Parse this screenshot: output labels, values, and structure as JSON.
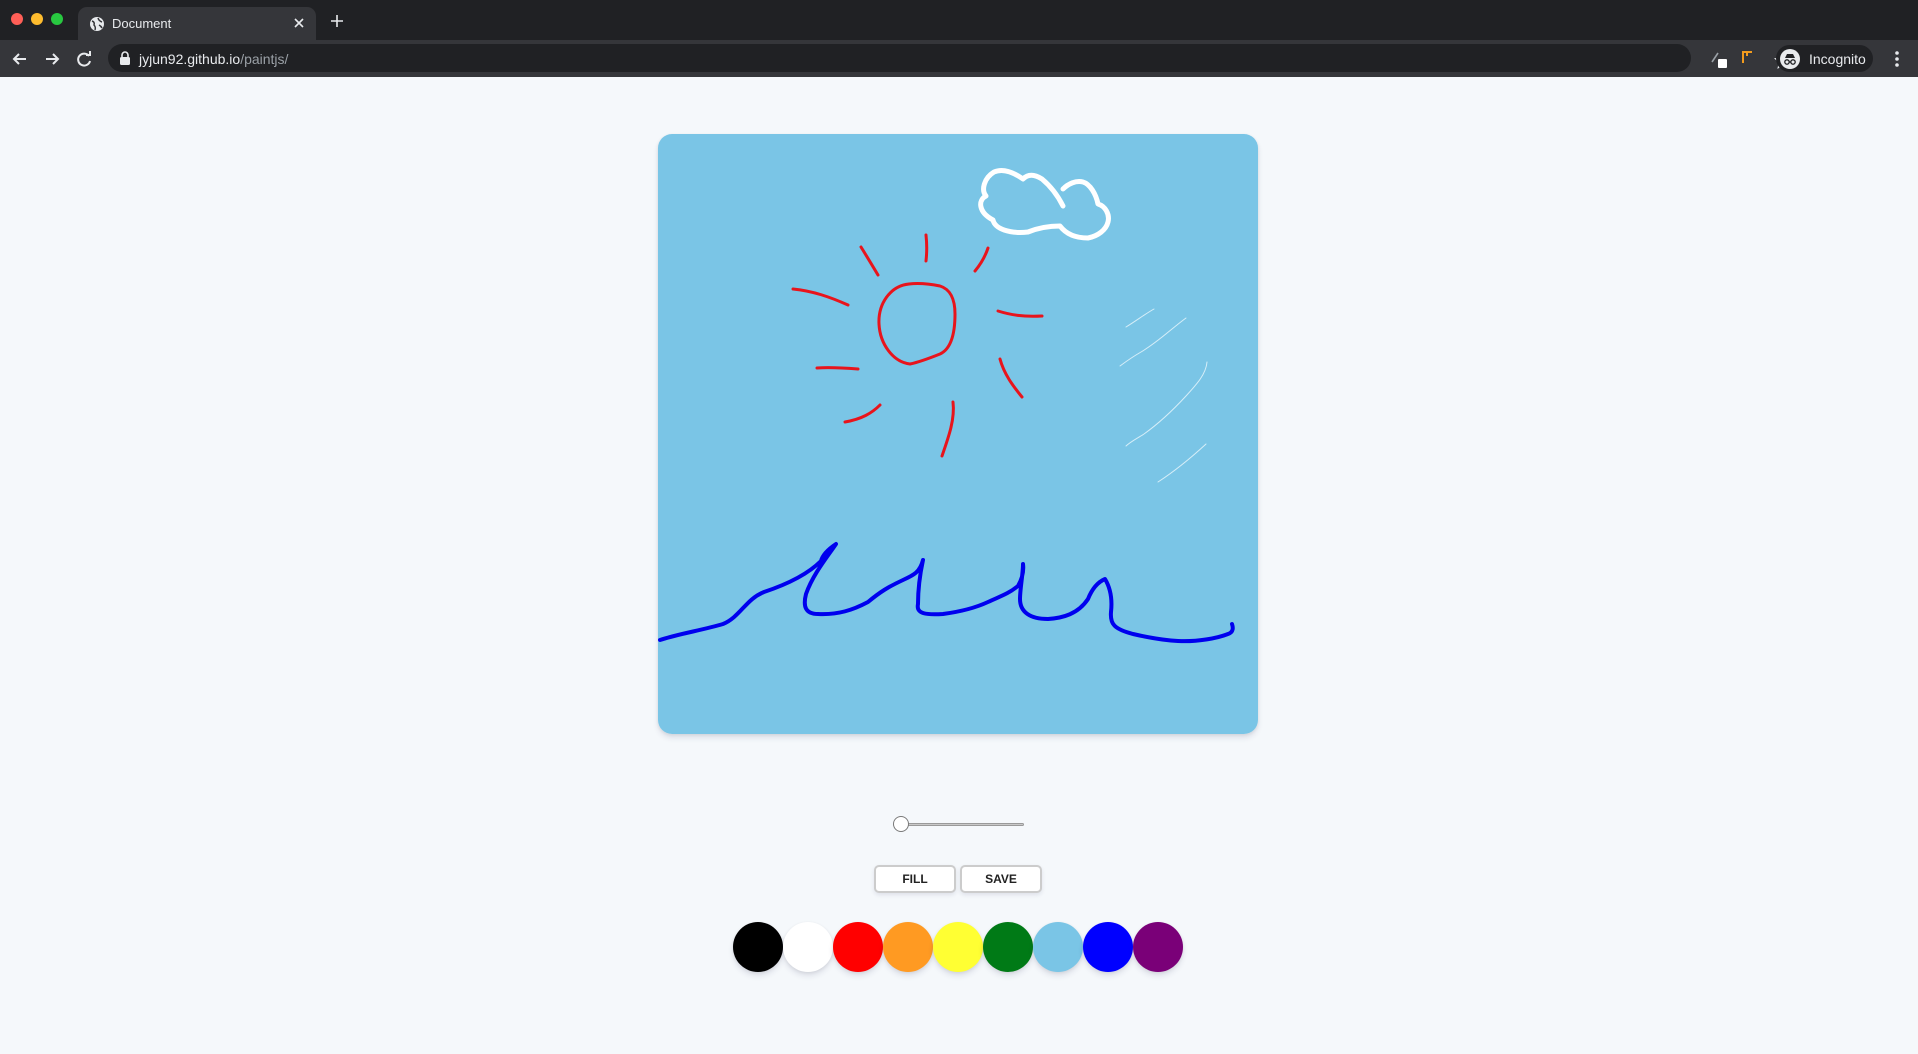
{
  "browser": {
    "tab_title": "Document",
    "url_host": "jyjun92.github.io",
    "url_path": "/paintjs/",
    "profile_label": "Incognito",
    "icons": [
      "globe-icon",
      "close-icon",
      "plus-icon",
      "back-arrow-icon",
      "forward-arrow-icon",
      "reload-icon",
      "lock-icon",
      "star-icon",
      "extension-icon",
      "extension-icon",
      "incognito-icon",
      "more-vert-icon"
    ]
  },
  "paint": {
    "canvas_background": "#7ac5e6",
    "brush_size": {
      "value": 0.0,
      "note": "slider at minimum"
    },
    "buttons": {
      "fill": "Fill",
      "save": "Save"
    },
    "palette": [
      "#000000",
      "#ffffff",
      "#ff0000",
      "#ff9a22",
      "#ffff33",
      "#007a16",
      "#7ac5e6",
      "#0000ff",
      "#7a0078"
    ],
    "stroke_colors": {
      "sun": "#e8141c",
      "cloud": "#ffffff",
      "waves": "#0000ee",
      "rain": "#d6eef8"
    }
  }
}
